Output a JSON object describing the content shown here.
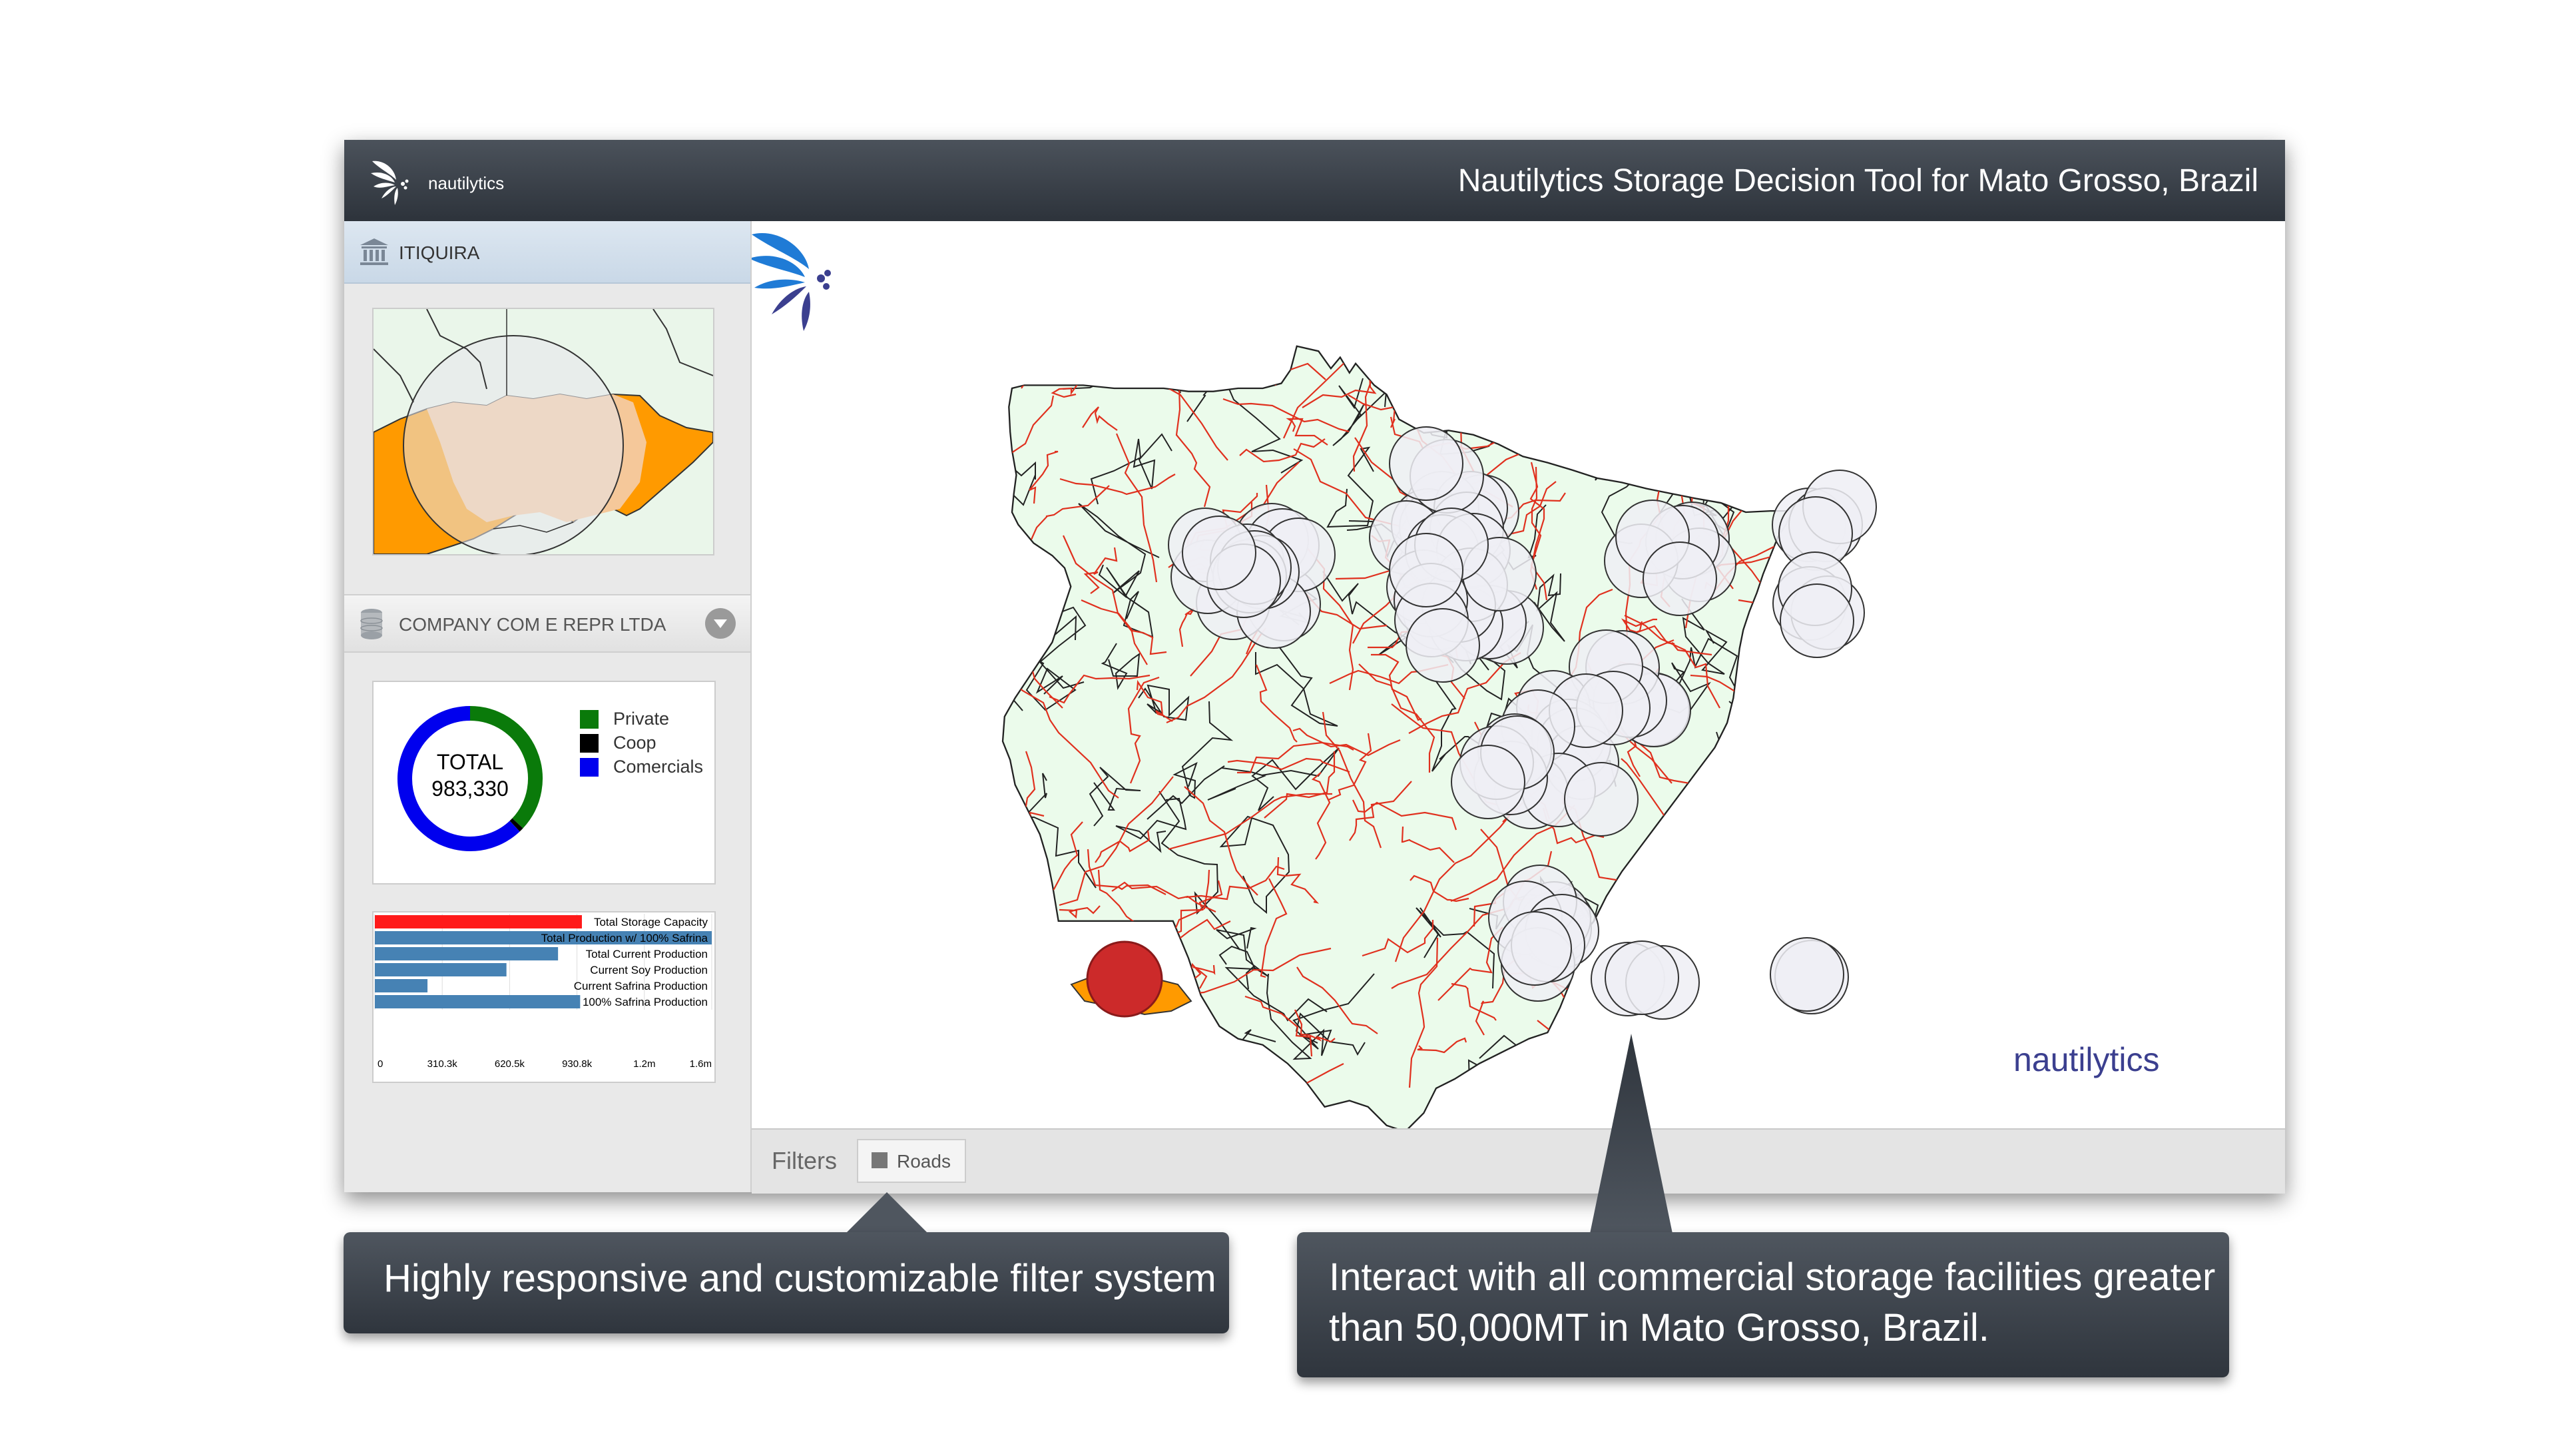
{
  "app": {
    "brand": "nautilytics",
    "title": "Nautilytics Storage Decision Tool for Mato Grosso, Brazil"
  },
  "sidebar": {
    "location": {
      "label": "ITIQUIRA",
      "icon": "building-icon"
    },
    "company": {
      "label": "COMPANY COM E REPR LTDA",
      "icon": "database-icon",
      "dropdown_icon": "chevron-down-icon"
    },
    "donut": {
      "total_label": "TOTAL",
      "total_value": "983,330",
      "legend": [
        {
          "label": "Private",
          "color": "#0a7a0a"
        },
        {
          "label": "Coop",
          "color": "#000000"
        },
        {
          "label": "Comercials",
          "color": "#0000ee"
        }
      ]
    }
  },
  "chart_data": {
    "type": "bar",
    "orientation": "horizontal",
    "categories": [
      "Total Storage Capacity",
      "Total Production w/ 100% Safrina",
      "Total Current Production",
      "Current Soy Production",
      "Current Safrina Production",
      "100% Safrina Production"
    ],
    "values": [
      983330,
      1600000,
      870000,
      625000,
      250000,
      975000
    ],
    "colors": [
      "#ff1a1a",
      "#4682b4",
      "#4682b4",
      "#4682b4",
      "#4682b4",
      "#4682b4"
    ],
    "xlim": [
      0,
      1600000
    ],
    "x_tick_labels": [
      "0",
      "310.3k",
      "620.5k",
      "930.8k",
      "1.2m",
      "1.6m"
    ],
    "grid": true
  },
  "donut_data": {
    "type": "pie",
    "slices": [
      {
        "label": "Private",
        "fraction": 0.37
      },
      {
        "label": "Coop",
        "fraction": 0.01
      },
      {
        "label": "Comercials",
        "fraction": 0.62
      }
    ]
  },
  "map": {
    "region": "Mato Grosso, Brazil",
    "colors": {
      "fill": "#ebfbeb",
      "border": "#222222",
      "roads": "#e0301e",
      "facility": "#eeeef4",
      "selected": "#d02828",
      "selected_area": "#ff9900"
    },
    "facility_count": 60
  },
  "filters": {
    "label": "Filters",
    "items": [
      {
        "label": "Roads",
        "icon": "square-icon"
      }
    ]
  },
  "callouts": {
    "left": "Highly responsive and customizable filter system",
    "right": "Interact with all commercial storage facilities greater than 50,000MT in Mato Grosso, Brazil."
  },
  "colors": {
    "titlebar": "#353b43",
    "accent": "#3b3f8f"
  }
}
